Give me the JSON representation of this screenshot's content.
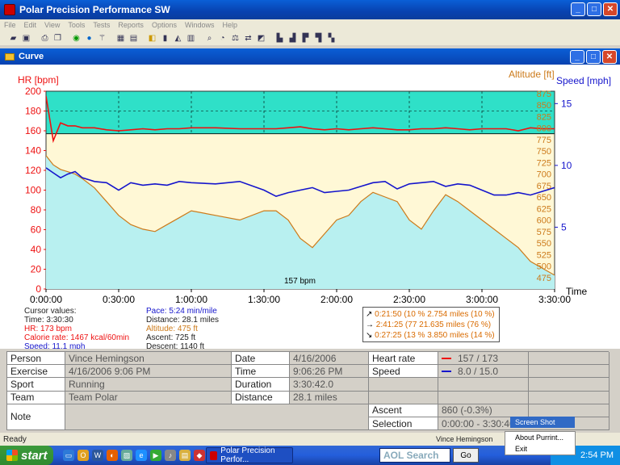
{
  "window": {
    "title": "Polar Precision Performance SW"
  },
  "menu": [
    "File",
    "Edit",
    "View",
    "Tools",
    "Tests",
    "Reports",
    "Options",
    "Windows",
    "Help"
  ],
  "child_window": {
    "title": "Curve"
  },
  "chart_data": {
    "type": "line",
    "hr_axis_label": "HR [bpm]",
    "altitude_axis_label": "Altitude [ft]",
    "speed_axis_label": "Speed [mph]",
    "x_axis_label": "Time",
    "hr_ticks": [
      "200",
      "180",
      "160",
      "140",
      "120",
      "100",
      "80",
      "60",
      "40",
      "20",
      "0"
    ],
    "altitude_ticks": [
      "875",
      "850",
      "825",
      "800",
      "775",
      "750",
      "725",
      "700",
      "675",
      "650",
      "625",
      "600",
      "575",
      "550",
      "525",
      "500",
      "475"
    ],
    "speed_ticks": [
      "15",
      "10",
      "5"
    ],
    "x_ticks": [
      "0:00:00",
      "0:30:00",
      "1:00:00",
      "1:30:00",
      "2:00:00",
      "2:30:00",
      "3:00:00",
      "3:30:00"
    ],
    "hr_ylim": [
      0,
      200
    ],
    "speed_ylim": [
      0,
      16
    ],
    "altitude_ylim": [
      450,
      880
    ],
    "threshold_label": "157 bpm",
    "threshold_bpm": 157,
    "colors": {
      "hr": "#ee1111",
      "speed": "#1515cc",
      "altitude": "#cc7a1a",
      "zone": "#2fe0c8",
      "below_zone": "#fff8d6",
      "lower_fill": "#b8f0f0"
    },
    "x_minutes": [
      0,
      3,
      6,
      9,
      12,
      15,
      20,
      25,
      30,
      35,
      40,
      45,
      50,
      55,
      60,
      70,
      80,
      90,
      95,
      100,
      105,
      110,
      115,
      120,
      125,
      130,
      135,
      140,
      145,
      150,
      155,
      160,
      165,
      170,
      175,
      180,
      185,
      190,
      195,
      200,
      205,
      210
    ],
    "hr": [
      195,
      150,
      168,
      165,
      165,
      163,
      163,
      161,
      160,
      161,
      162,
      161,
      162,
      162,
      163,
      163,
      162,
      162,
      162,
      163,
      164,
      162,
      161,
      162,
      161,
      162,
      163,
      162,
      161,
      161,
      162,
      162,
      163,
      162,
      161,
      162,
      162,
      162,
      160,
      163,
      162,
      162
    ],
    "speed": [
      9.8,
      9.4,
      9.0,
      9.3,
      9.5,
      9.0,
      8.7,
      8.6,
      8.0,
      8.6,
      8.4,
      8.5,
      8.4,
      8.7,
      8.6,
      8.5,
      8.7,
      8.0,
      7.5,
      7.8,
      8.0,
      8.2,
      7.8,
      7.9,
      8.0,
      8.3,
      8.6,
      8.7,
      8.1,
      8.5,
      8.6,
      8.7,
      8.3,
      8.5,
      8.4,
      8.0,
      7.6,
      7.6,
      7.8,
      7.6,
      7.9,
      8.2
    ],
    "altitude": [
      740,
      720,
      710,
      705,
      700,
      690,
      670,
      640,
      610,
      590,
      580,
      575,
      590,
      605,
      620,
      610,
      600,
      620,
      620,
      600,
      560,
      540,
      570,
      600,
      610,
      640,
      660,
      650,
      640,
      600,
      580,
      620,
      655,
      640,
      620,
      600,
      580,
      560,
      540,
      510,
      495,
      480
    ]
  },
  "cursor_values": {
    "heading": "Cursor values:",
    "time": "Time: 3:30:30",
    "hr": "HR: 173 bpm",
    "calorie": "Calorie rate: 1467 kcal/60min",
    "speed": "Speed: 11.1 mph",
    "pace": "Pace: 5:24 min/mile",
    "distance": "Distance: 28.1 miles",
    "altitude": "Altitude: 475 ft",
    "ascent": "Ascent: 725 ft",
    "descent": "Descent: 1140 ft"
  },
  "laps": [
    {
      "arrow": "↗",
      "text": "0:21:50  (10 % 2.754 miles  (10 %)"
    },
    {
      "arrow": "→",
      "text": "2:41:25  (77  21.635 miles  (76 %)"
    },
    {
      "arrow": "↘",
      "text": "0:27:25  (13 % 3.850 miles  (14 %)"
    }
  ],
  "info": {
    "person_label": "Person",
    "person": "Vince Hemingson",
    "exercise_label": "Exercise",
    "exercise": "4/16/2006 9:06 PM",
    "sport_label": "Sport",
    "sport": "Running",
    "team_label": "Team",
    "team": "Team Polar",
    "note_label": "Note",
    "date_label": "Date",
    "date": "4/16/2006",
    "time_label": "Time",
    "time": "9:06:26 PM",
    "duration_label": "Duration",
    "duration": "3:30:42.0",
    "distance_label": "Distance",
    "distance": "28.1 miles",
    "hr_label": "Heart rate",
    "hr": "157 / 173",
    "speed_label": "Speed",
    "speed": "8.0 / 15.0",
    "ascent_label": "Ascent",
    "ascent": "860 (-0.3%)",
    "selection_label": "Selection",
    "selection": "0:00:00 - 3:30:40"
  },
  "status": {
    "text": "Ready",
    "user": "Vince Hemingson"
  },
  "taskbar": {
    "start": "start",
    "task": "Polar Precision Perfor...",
    "search": "AOL Search",
    "go": "Go",
    "clock": "2:54 PM"
  },
  "context_menu": {
    "tooltip": "Screen Shot",
    "items": [
      "About Purrint...",
      "Exit"
    ]
  }
}
